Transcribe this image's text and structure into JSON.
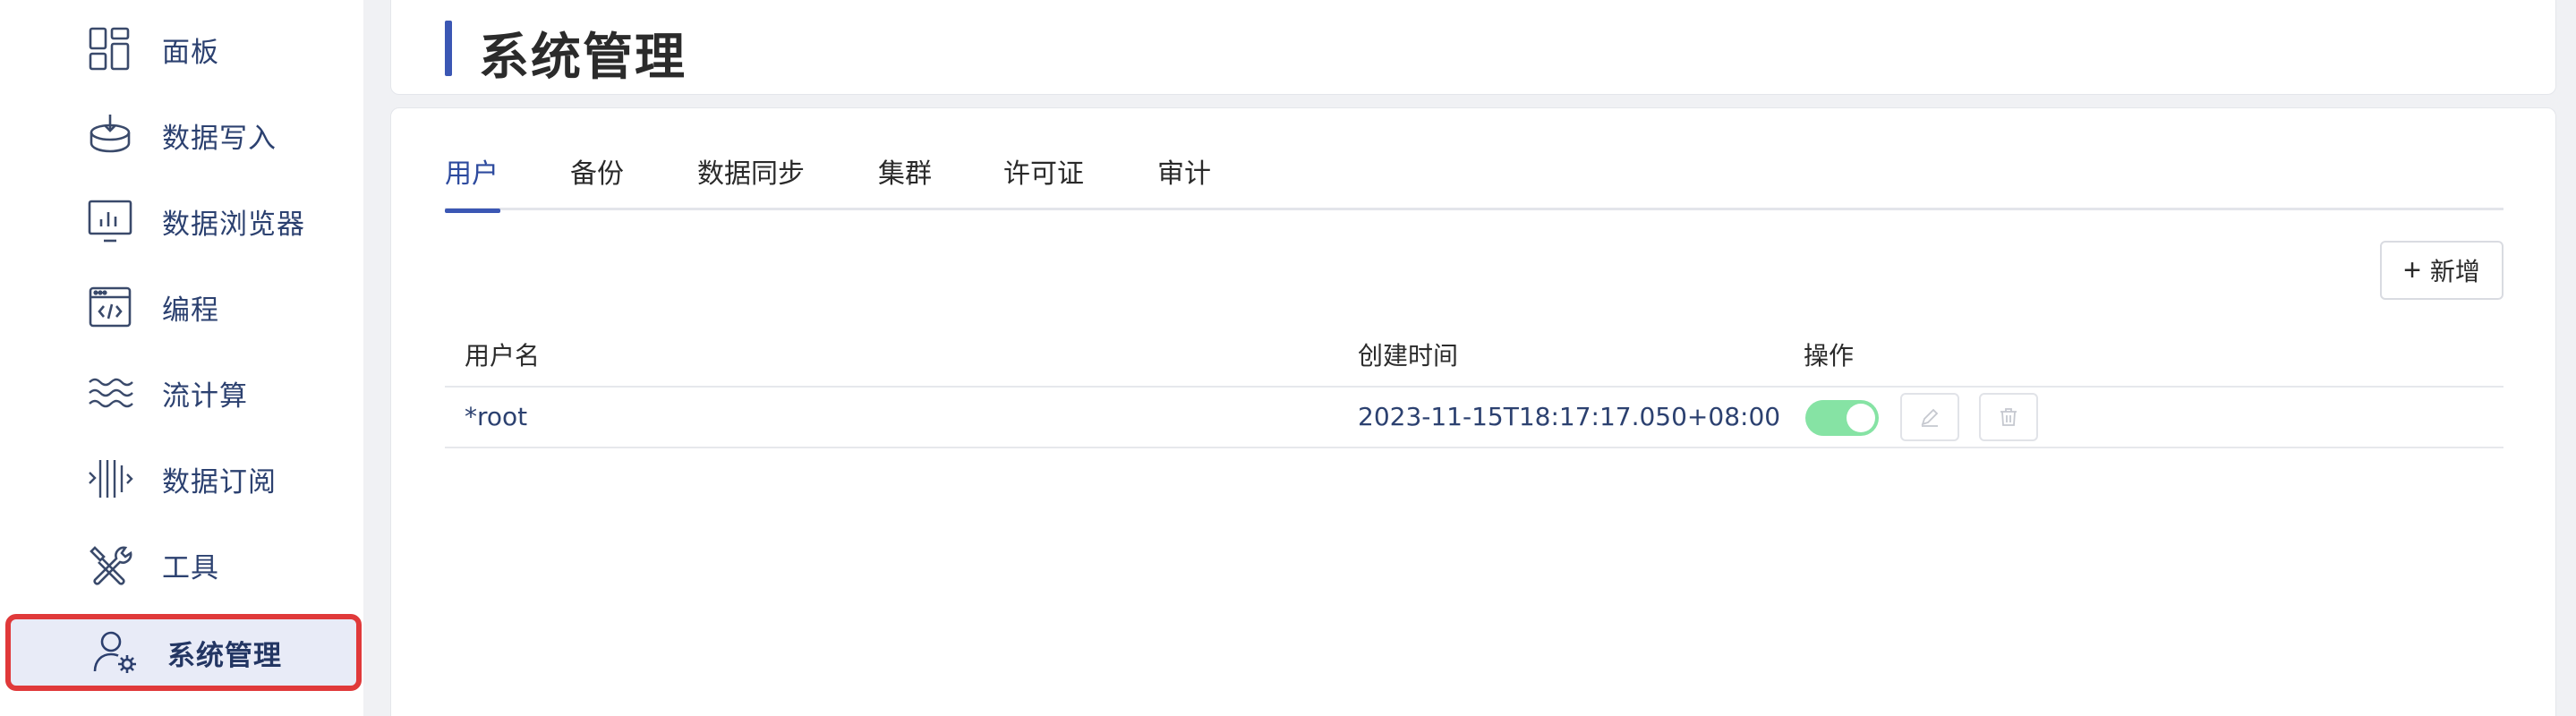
{
  "sidebar": {
    "items": [
      {
        "label": "面板",
        "icon": "dashboard-icon"
      },
      {
        "label": "数据写入",
        "icon": "data-import-icon"
      },
      {
        "label": "数据浏览器",
        "icon": "chart-browser-icon"
      },
      {
        "label": "编程",
        "icon": "code-window-icon"
      },
      {
        "label": "流计算",
        "icon": "stream-waves-icon"
      },
      {
        "label": "数据订阅",
        "icon": "subscription-icon"
      },
      {
        "label": "工具",
        "icon": "tools-icon"
      },
      {
        "label": "系统管理",
        "icon": "user-settings-icon",
        "active": true
      }
    ]
  },
  "header": {
    "title": "系统管理"
  },
  "tabs": [
    {
      "label": "用户",
      "active": true
    },
    {
      "label": "备份"
    },
    {
      "label": "数据同步"
    },
    {
      "label": "集群"
    },
    {
      "label": "许可证"
    },
    {
      "label": "审计"
    }
  ],
  "toolbar": {
    "add_label": "新增"
  },
  "table": {
    "columns": [
      "用户名",
      "创建时间",
      "操作"
    ],
    "rows": [
      {
        "username": "*root",
        "created": "2023-11-15T18:17:17.050+08:00",
        "enabled": true
      }
    ]
  },
  "colors": {
    "accent": "#3b57b4",
    "nav_text": "#2c4170",
    "highlight_border": "#e0393a",
    "toggle_on": "#86e3a4"
  }
}
